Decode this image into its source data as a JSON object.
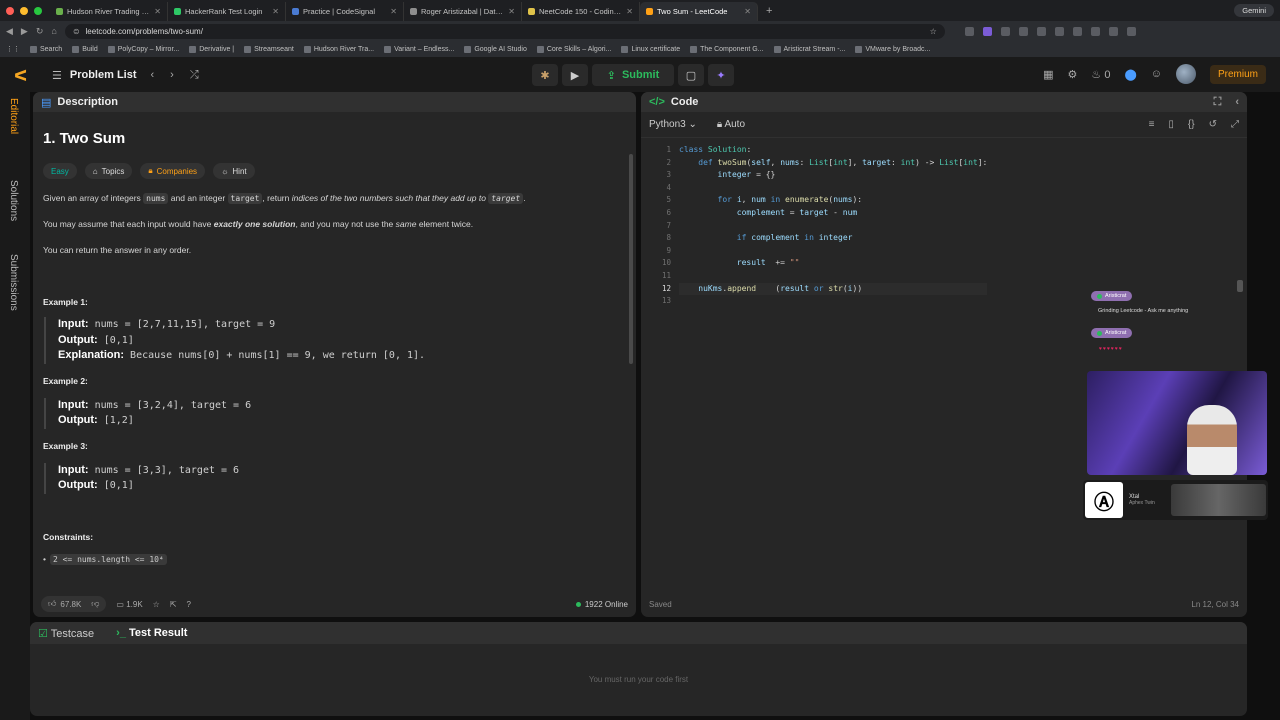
{
  "browser": {
    "tabs": [
      {
        "label": "Hudson River Trading - Juni",
        "color": "#6ab04c"
      },
      {
        "label": "HackerRank Test Login",
        "color": "#2ec866"
      },
      {
        "label": "Practice | CodeSignal",
        "color": "#4a7bd3"
      },
      {
        "label": "Roger Aristizabal | Data Anal",
        "color": "#8e8e8e"
      },
      {
        "label": "NeetCode 150 - Coding Interv",
        "color": "#e0c34a"
      },
      {
        "label": "Two Sum - LeetCode",
        "color": "#ffa116",
        "active": true
      }
    ],
    "profile": "Gemini",
    "url": "leetcode.com/problems/two-sum/",
    "bookmarks": [
      "Search",
      "Build",
      "PolyCopy – Mirror...",
      "Derivative |",
      "Streamseant",
      "Hudson River Tra...",
      "Variant – Endless...",
      "Google AI Studio",
      "Core Skills – Algori...",
      "Linux certificate",
      "The Component G...",
      "Aristicrat Stream -...",
      "VMware by Broadc..."
    ]
  },
  "nav": {
    "problem_list": "Problem List",
    "submit": "Submit",
    "streak": "0",
    "premium": "Premium"
  },
  "rail": {
    "editorial": "Editorial",
    "solutions": "Solutions",
    "submissions": "Submissions"
  },
  "description": {
    "tab": "Description",
    "title": "1. Two Sum",
    "tags": {
      "difficulty": "Easy",
      "topics": "Topics",
      "companies": "Companies",
      "hint": "Hint"
    },
    "p1_pre": "Given an array of integers ",
    "p1_nums": "nums",
    "p1_mid": " and an integer ",
    "p1_target": "target",
    "p1_mid2": ", return ",
    "p1_em": "indices of the two numbers such that they add up to ",
    "p1_target2": "target",
    "p1_end": ".",
    "p2_pre": "You may assume that each input would have ",
    "p2_bold": "exactly one solution",
    "p2_mid": ", and you may not use the ",
    "p2_em": "same",
    "p2_end": " element twice.",
    "p3": "You can return the answer in any order.",
    "examples": [
      {
        "title": "Example 1:",
        "input": "nums = [2,7,11,15], target = 9",
        "output": "[0,1]",
        "explanation": "Because nums[0] + nums[1] == 9, we return [0, 1]."
      },
      {
        "title": "Example 2:",
        "input": "nums = [3,2,4], target = 6",
        "output": "[1,2]"
      },
      {
        "title": "Example 3:",
        "input": "nums = [3,3], target = 6",
        "output": "[0,1]"
      }
    ],
    "labels": {
      "input": "Input:",
      "output": "Output:",
      "explanation": "Explanation:"
    },
    "constraints_title": "Constraints:",
    "constraint1": "2 <= nums.length <= 10⁴",
    "footer": {
      "likes": "67.8K",
      "comments": "1.9K",
      "online": "1922 Online"
    }
  },
  "code": {
    "tab": "Code",
    "language": "Python3",
    "mode": "Auto",
    "status": "Saved",
    "cursor": "Ln 12, Col 34",
    "line_numbers": [
      "1",
      "2",
      "3",
      "4",
      "5",
      "6",
      "7",
      "8",
      "9",
      "10",
      "11",
      "12",
      "13"
    ],
    "current_line": 12
  },
  "overlay": {
    "chat_user1": "Aristicrat",
    "chat_msg": "Grinding Leetcode - Ask me anything",
    "chat_user2": "Aristicrat",
    "music_title": "Xtal",
    "music_artist": "Aphex Twin"
  },
  "tests": {
    "testcase": "Testcase",
    "result": "Test Result",
    "hint": "You must run your code first"
  }
}
